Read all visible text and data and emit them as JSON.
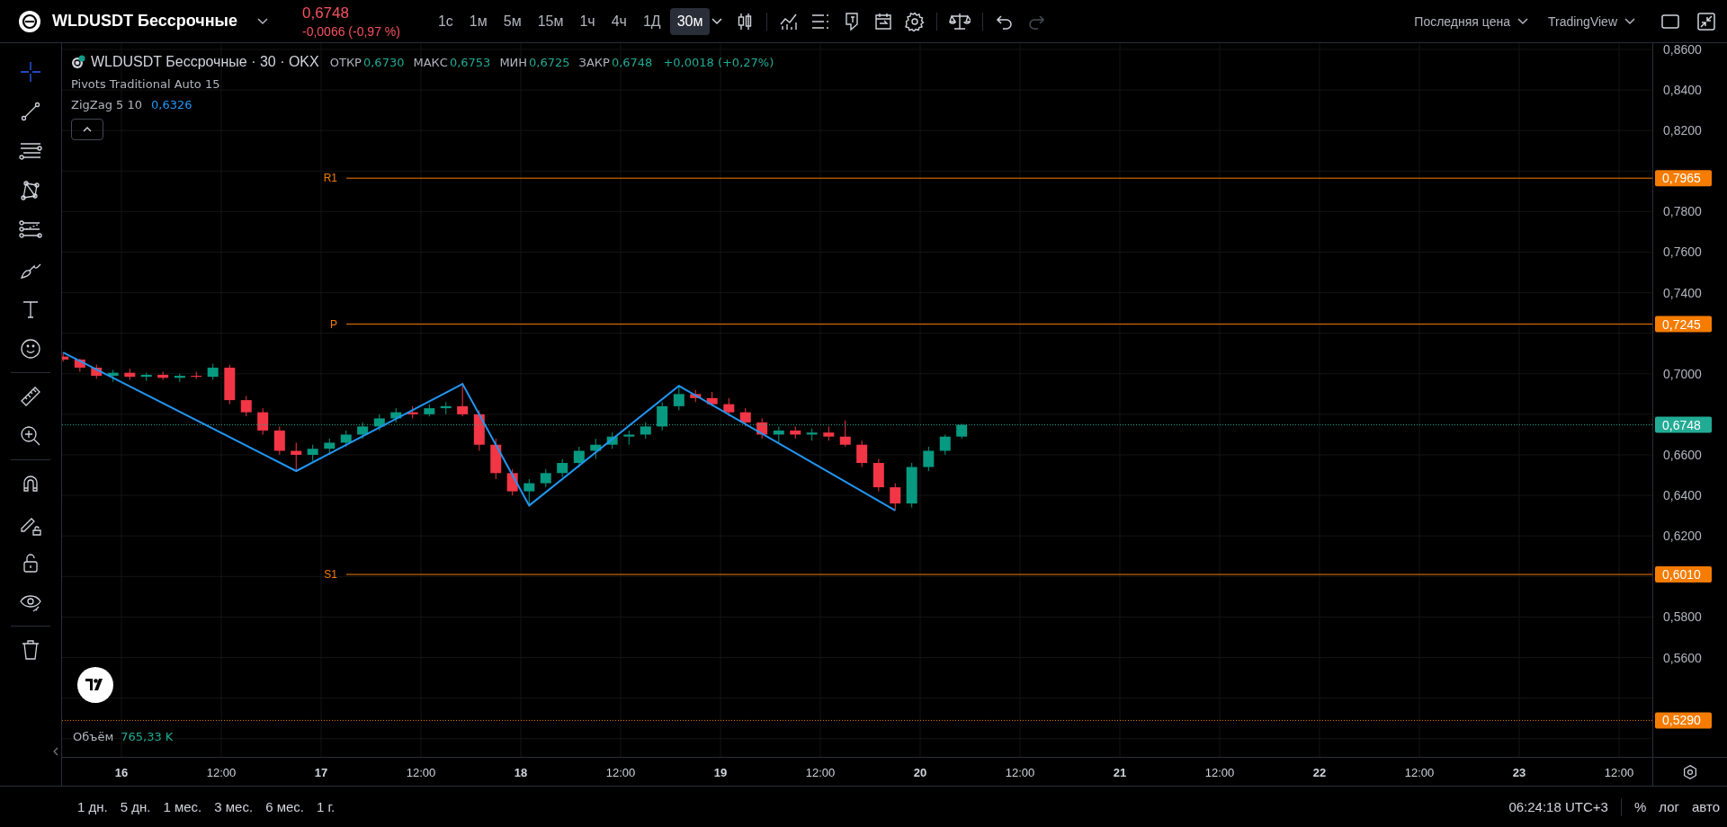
{
  "header": {
    "symbol": "WLDUSDT Бессрочные",
    "price": "0,6748",
    "change": "-0,0066 (-0,97 %)"
  },
  "intervals": [
    {
      "label": "1с",
      "selected": false
    },
    {
      "label": "1м",
      "selected": false
    },
    {
      "label": "5м",
      "selected": false
    },
    {
      "label": "15м",
      "selected": false
    },
    {
      "label": "1ч",
      "selected": false
    },
    {
      "label": "4ч",
      "selected": false
    },
    {
      "label": "1Д",
      "selected": false
    },
    {
      "label": "30м",
      "selected": true
    }
  ],
  "history": [
    {
      "kind": "undo",
      "disabled": false
    },
    {
      "kind": "redo",
      "disabled": true
    }
  ],
  "price_source": "Последняя цена",
  "theme_menu": "TradingView",
  "tool_groups": [
    [
      {
        "kind": "crosshair",
        "selected": true
      },
      {
        "kind": "trend-line",
        "selected": false
      },
      {
        "kind": "fib",
        "selected": false
      },
      {
        "kind": "pattern",
        "selected": false
      },
      {
        "kind": "projection",
        "selected": false
      },
      {
        "kind": "brush",
        "selected": false
      },
      {
        "kind": "text",
        "selected": false
      },
      {
        "kind": "emoji",
        "selected": false
      }
    ],
    [
      {
        "kind": "ruler",
        "selected": false
      },
      {
        "kind": "zoom",
        "selected": false
      }
    ],
    [
      {
        "kind": "magnet",
        "selected": false
      },
      {
        "kind": "lock-drawing",
        "selected": false
      },
      {
        "kind": "lock",
        "selected": false
      },
      {
        "kind": "eye",
        "selected": false
      }
    ],
    [
      {
        "kind": "trash",
        "selected": false
      }
    ]
  ],
  "legend": {
    "title": "WLDUSDT Бессрочные · 30 · OKX",
    "ohlc": [
      {
        "label": "ОТКР",
        "value": "0,6730"
      },
      {
        "label": "МАКС",
        "value": "0,6753"
      },
      {
        "label": "МИН",
        "value": "0,6725"
      },
      {
        "label": "ЗАКР",
        "value": "0,6748"
      }
    ],
    "change": "+0,0018 (+0,27%)",
    "pivots_name": "Pivots Traditional Auto 15",
    "zigzag_name": "ZigZag 5 10",
    "zigzag_value": "0,6326"
  },
  "volume": {
    "label": "Объём",
    "value": "765,33 K"
  },
  "chart_data": {
    "type": "candlestick",
    "x": [
      15.708,
      15.792,
      15.875,
      15.958,
      16.042,
      16.125,
      16.208,
      16.292,
      16.375,
      16.458,
      16.542,
      16.625,
      16.708,
      16.792,
      16.875,
      16.958,
      17.042,
      17.125,
      17.208,
      17.292,
      17.375,
      17.458,
      17.542,
      17.625,
      17.708,
      17.792,
      17.875,
      17.958,
      18.042,
      18.125,
      18.208,
      18.292,
      18.375,
      18.458,
      18.542,
      18.625,
      18.708,
      18.792,
      18.875,
      18.958,
      19.042,
      19.125,
      19.208,
      19.292,
      19.375,
      19.458,
      19.542,
      19.625,
      19.708,
      19.792,
      19.875,
      19.958,
      20.042,
      20.125,
      20.208
    ],
    "ohlc": [
      [
        0.7085,
        0.7105,
        0.706,
        0.707
      ],
      [
        0.707,
        0.7075,
        0.701,
        0.703
      ],
      [
        0.703,
        0.7045,
        0.6975,
        0.699
      ],
      [
        0.699,
        0.702,
        0.696,
        0.7005
      ],
      [
        0.7005,
        0.7025,
        0.697,
        0.6985
      ],
      [
        0.6985,
        0.7005,
        0.6965,
        0.6995
      ],
      [
        0.6995,
        0.701,
        0.697,
        0.698
      ],
      [
        0.698,
        0.7,
        0.696,
        0.699
      ],
      [
        0.699,
        0.701,
        0.6975,
        0.6985
      ],
      [
        0.6985,
        0.705,
        0.697,
        0.703
      ],
      [
        0.703,
        0.7045,
        0.685,
        0.687
      ],
      [
        0.687,
        0.689,
        0.679,
        0.681
      ],
      [
        0.681,
        0.683,
        0.67,
        0.672
      ],
      [
        0.672,
        0.674,
        0.66,
        0.662
      ],
      [
        0.662,
        0.666,
        0.652,
        0.66
      ],
      [
        0.66,
        0.665,
        0.657,
        0.663
      ],
      [
        0.663,
        0.668,
        0.66,
        0.666
      ],
      [
        0.666,
        0.672,
        0.664,
        0.67
      ],
      [
        0.67,
        0.676,
        0.668,
        0.674
      ],
      [
        0.674,
        0.68,
        0.672,
        0.678
      ],
      [
        0.678,
        0.683,
        0.676,
        0.681
      ],
      [
        0.681,
        0.684,
        0.678,
        0.68
      ],
      [
        0.68,
        0.685,
        0.679,
        0.683
      ],
      [
        0.683,
        0.686,
        0.68,
        0.684
      ],
      [
        0.684,
        0.695,
        0.679,
        0.68
      ],
      [
        0.68,
        0.682,
        0.662,
        0.665
      ],
      [
        0.665,
        0.668,
        0.648,
        0.651
      ],
      [
        0.651,
        0.653,
        0.64,
        0.642
      ],
      [
        0.642,
        0.648,
        0.635,
        0.646
      ],
      [
        0.646,
        0.653,
        0.644,
        0.651
      ],
      [
        0.651,
        0.658,
        0.649,
        0.656
      ],
      [
        0.656,
        0.664,
        0.654,
        0.662
      ],
      [
        0.662,
        0.668,
        0.658,
        0.665
      ],
      [
        0.665,
        0.671,
        0.663,
        0.669
      ],
      [
        0.669,
        0.672,
        0.665,
        0.67
      ],
      [
        0.67,
        0.676,
        0.668,
        0.674
      ],
      [
        0.674,
        0.686,
        0.672,
        0.684
      ],
      [
        0.684,
        0.694,
        0.682,
        0.69
      ],
      [
        0.69,
        0.692,
        0.686,
        0.688
      ],
      [
        0.688,
        0.691,
        0.684,
        0.685
      ],
      [
        0.685,
        0.688,
        0.679,
        0.681
      ],
      [
        0.681,
        0.683,
        0.674,
        0.676
      ],
      [
        0.676,
        0.678,
        0.668,
        0.67
      ],
      [
        0.67,
        0.674,
        0.666,
        0.672
      ],
      [
        0.672,
        0.674,
        0.668,
        0.67
      ],
      [
        0.67,
        0.673,
        0.667,
        0.671
      ],
      [
        0.671,
        0.674,
        0.667,
        0.669
      ],
      [
        0.669,
        0.677,
        0.664,
        0.665
      ],
      [
        0.665,
        0.667,
        0.654,
        0.656
      ],
      [
        0.656,
        0.658,
        0.642,
        0.644
      ],
      [
        0.644,
        0.646,
        0.6326,
        0.636
      ],
      [
        0.636,
        0.656,
        0.634,
        0.654
      ],
      [
        0.654,
        0.664,
        0.652,
        0.662
      ],
      [
        0.662,
        0.67,
        0.66,
        0.669
      ],
      [
        0.669,
        0.6753,
        0.668,
        0.6748
      ]
    ],
    "grid": true,
    "xlim": [
      15.7027,
      24.036
    ],
    "ylim": [
      0.511,
      0.8631
    ],
    "xticks": [
      {
        "value": 16,
        "label": "16"
      },
      {
        "value": 17,
        "label": "17"
      },
      {
        "value": 18,
        "label": "18"
      },
      {
        "value": 19,
        "label": "19"
      },
      {
        "value": 20,
        "label": "20"
      },
      {
        "value": 21,
        "label": "21"
      },
      {
        "value": 22,
        "label": "22"
      },
      {
        "value": 23,
        "label": "23"
      }
    ],
    "yticks": [
      {
        "value": 0.86,
        "label": "0,8600"
      },
      {
        "value": 0.84,
        "label": "0,8400"
      },
      {
        "value": 0.82,
        "label": "0,8200"
      },
      {
        "value": 0.78,
        "label": "0,7800"
      },
      {
        "value": 0.76,
        "label": "0,7600"
      },
      {
        "value": 0.74,
        "label": "0,7400"
      },
      {
        "value": 0.7,
        "label": "0,7000"
      },
      {
        "value": 0.66,
        "label": "0,6600"
      },
      {
        "value": 0.64,
        "label": "0,6400"
      },
      {
        "value": 0.62,
        "label": "0,6200"
      },
      {
        "value": 0.58,
        "label": "0,5800"
      },
      {
        "value": 0.56,
        "label": "0,5600"
      }
    ],
    "ref_lines": [
      {
        "axis": "y",
        "value": 0.7965,
        "label": "R1",
        "color": "#f57c00"
      },
      {
        "axis": "y",
        "value": 0.7245,
        "label": "P",
        "color": "#f57c00"
      },
      {
        "axis": "y",
        "value": 0.6748,
        "color": "#22ab94"
      },
      {
        "axis": "y",
        "value": 0.601,
        "label": "S1",
        "color": "#f57c00"
      },
      {
        "axis": "y",
        "value": 0.529,
        "color": "#f57c00"
      }
    ]
  },
  "price_labels": [
    "0,7965",
    "0,7245",
    "0,6748",
    "0,6010",
    "0,5290"
  ],
  "midday_labels": [
    "12:00",
    "12:00",
    "12:00",
    "12:00",
    "12:00",
    "12:00",
    "12:00",
    "12:00"
  ],
  "ranges": [
    "1 дн.",
    "5 дн.",
    "1 мес.",
    "3 мес.",
    "6 мес.",
    "1 г."
  ],
  "status": {
    "time": "06:24:18 UTC+3",
    "percent": "%",
    "log": "лог",
    "auto": "авто"
  }
}
